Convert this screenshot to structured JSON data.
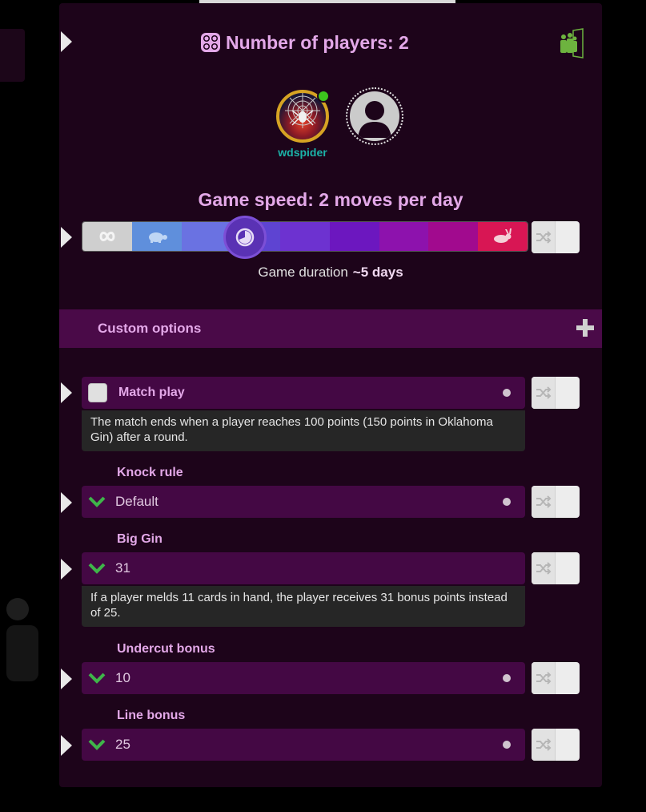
{
  "header": {
    "title": "Number of players: 2"
  },
  "players": [
    {
      "name": "wdspider",
      "online": true
    },
    {
      "name": "",
      "online": false
    }
  ],
  "speed": {
    "title": "Game speed: 2 moves per day",
    "duration_label": "Game duration",
    "duration_value": "~5 days",
    "selected_index": 3,
    "segment_colors": [
      "#cfcfcf",
      "#5f8fdc",
      "#6a72e2",
      "#5e44d2",
      "#6d32d0",
      "#6c17bf",
      "#8d12ad",
      "#a10a8e",
      "#d81654"
    ]
  },
  "custom": {
    "title": "Custom options"
  },
  "options": {
    "match_play": {
      "label": "Match play",
      "checked": false,
      "description": "The match ends when a player reaches 100 points (150 points in Oklahoma Gin) after a round."
    },
    "knock_rule": {
      "label": "Knock rule",
      "value": "Default"
    },
    "big_gin": {
      "label": "Big Gin",
      "value": "31",
      "description": "If a player melds 11 cards in hand, the player receives 31 bonus points instead of 25."
    },
    "undercut_bonus": {
      "label": "Undercut bonus",
      "value": "10"
    },
    "line_bonus": {
      "label": "Line bonus",
      "value": "25"
    }
  },
  "colors": {
    "accent": "#e3a8e8",
    "panel": "#1d041a",
    "row": "#440844",
    "header": "#4a0a48",
    "online": "#3cc51d"
  }
}
